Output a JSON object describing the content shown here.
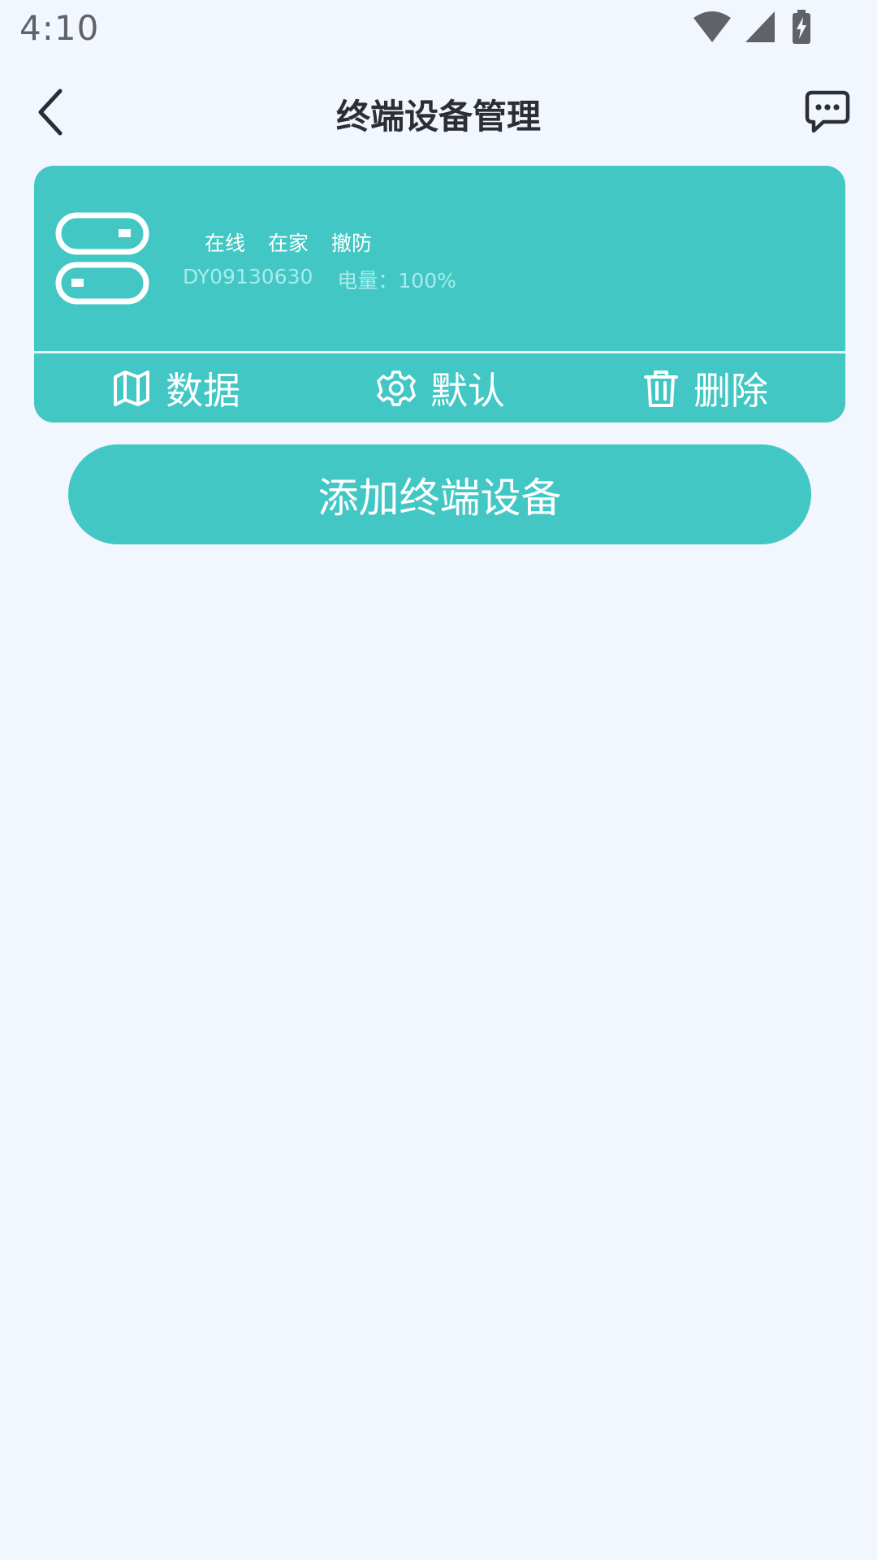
{
  "status_bar": {
    "time": "4:10"
  },
  "header": {
    "title": "终端设备管理"
  },
  "device": {
    "tags": [
      "在线",
      "在家",
      "撤防"
    ],
    "id": "DY09130630",
    "battery": "电量：100%",
    "actions": {
      "data_label": "数据",
      "default_label": "默认",
      "delete_label": "删除"
    }
  },
  "add_button_label": "添加终端设备",
  "colors": {
    "accent": "#42c7c4",
    "background": "#f1f6ff",
    "title": "#2b2f33"
  }
}
